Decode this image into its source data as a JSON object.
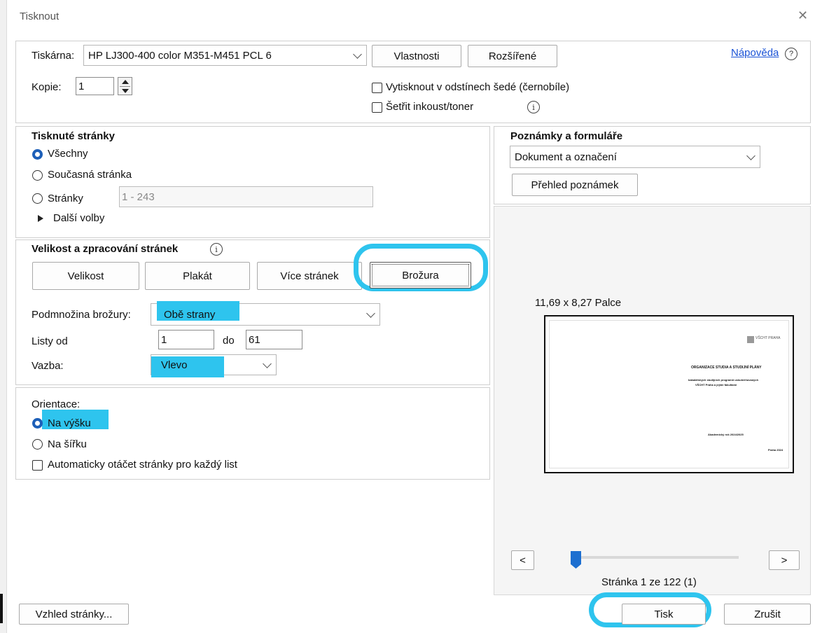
{
  "window": {
    "title": "Tisknout",
    "close_glyph": "✕"
  },
  "printer": {
    "label": "Tiskárna:",
    "value": "HP LJ300-400 color M351-M451 PCL 6",
    "properties_label": "Vlastnosti",
    "advanced_label": "Rozšířené",
    "help_label": "Nápověda",
    "help_icon_glyph": "?"
  },
  "copies": {
    "label": "Kopie:",
    "value": "1"
  },
  "options": {
    "grayscale_label": "Vytisknout v odstínech šedé (černobíle)",
    "grayscale_checked": false,
    "save_ink_label": "Šetřit inkoust/toner",
    "save_ink_checked": false,
    "info_glyph": "i"
  },
  "pages_to_print": {
    "heading": "Tisknuté stránky",
    "all_label": "Všechny",
    "current_label": "Současná stránka",
    "pages_label": "Stránky",
    "pages_value": "1 - 243",
    "more_options_label": "Další volby",
    "selected": "all"
  },
  "page_sizing": {
    "heading": "Velikost a zpracování stránek",
    "size_label": "Velikost",
    "poster_label": "Plakát",
    "multiple_label": "Více stránek",
    "booklet_label": "Brožura",
    "active": "booklet",
    "booklet_subset_label": "Podmnožina brožury:",
    "booklet_subset_value": "Obě strany",
    "sheets_from_label": "Listy od",
    "sheets_from_value": "1",
    "sheets_to_label": "do",
    "sheets_to_value": "61",
    "binding_label": "Vazba:",
    "binding_value": "Vlevo"
  },
  "orientation": {
    "heading": "Orientace:",
    "portrait_label": "Na výšku",
    "landscape_label": "Na šířku",
    "selected": "portrait",
    "auto_rotate_label": "Automaticky otáčet stránky pro každý list",
    "auto_rotate_checked": false
  },
  "comments_forms": {
    "heading": "Poznámky a formuláře",
    "value": "Dokument a označení",
    "summary_label": "Přehled poznámek"
  },
  "preview": {
    "size_text": "11,69 x 8,27 Palce",
    "page_status": "Stránka 1 ze 122 (1)",
    "prev_glyph": "<",
    "next_glyph": ">",
    "slider_position": 0.0,
    "doc": {
      "logo_text": "VŠCHT PRAHA",
      "title": "ORGANIZACE STUDIA A STUDIJNÍ PLÁNY",
      "subtitle_1": "bakalářských studijních programů uskutečňovaných",
      "subtitle_2": "VŠCHT Praha a jejími fakultami",
      "year": "Akademický rok 2024/2025",
      "city": "Praha 2024"
    }
  },
  "footer": {
    "page_setup_label": "Vzhled stránky...",
    "print_label": "Tisk",
    "cancel_label": "Zrušit"
  },
  "colors": {
    "highlight": "#2ec4ee",
    "link": "#1a53d6",
    "radio_on": "#1d5fb8"
  }
}
